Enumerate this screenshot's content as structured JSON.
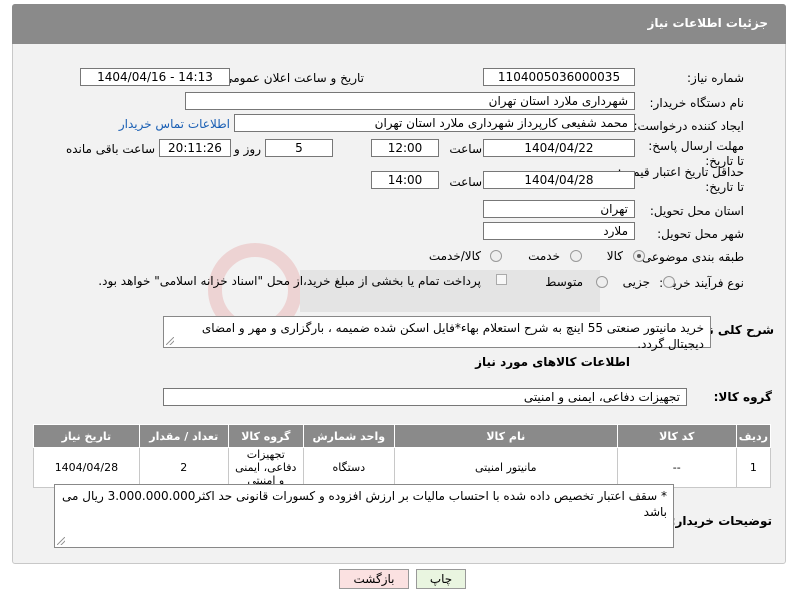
{
  "header": {
    "title": "جزئیات اطلاعات نیاز"
  },
  "form": {
    "need_number_label": "شماره نیاز:",
    "need_number": "1104005036000035",
    "announce_label": "تاریخ و ساعت اعلان عمومی:",
    "announce_value": "1404/04/16 - 14:13",
    "buyer_org_label": "نام دستگاه خریدار:",
    "buyer_org": "شهرداری ملارد استان تهران",
    "requester_label": "ایجاد کننده درخواست:",
    "requester": "محمد شفیعی کارپرداز شهرداری ملارد استان تهران",
    "contact_link": "اطلاعات تماس خریدار",
    "deadline_label": "مهلت ارسال پاسخ: تا تاریخ:",
    "deadline_date": "1404/04/22",
    "time_label": "ساعت",
    "deadline_time": "12:00",
    "days_value": "5",
    "days_label": "روز و",
    "remaining_time": "20:11:26",
    "remaining_label": "ساعت باقی مانده",
    "min_price_label": "حداقل تاریخ اعتبار قیمت: تا تاریخ:",
    "min_price_date": "1404/04/28",
    "min_price_time": "14:00",
    "province_label": "استان محل تحویل:",
    "province": "تهران",
    "city_label": "شهر محل تحویل:",
    "city": "ملارد",
    "category_label": "طبقه بندی موضوعی:",
    "category_options": [
      "کالا",
      "خدمت",
      "کالا/خدمت"
    ],
    "process_label": "نوع فرآیند خرید :",
    "process_options": [
      "جزیی",
      "متوسط"
    ],
    "payment_note": "پرداخت تمام یا بخشی از مبلغ خرید،از محل \"اسناد خزانه اسلامی\" خواهد بود."
  },
  "description": {
    "label": "شرح کلی نیاز:",
    "text": "خرید مانیتور صنعتی 55 اینچ به شرح استعلام بهاء*فایل اسکن شده ضمیمه ، بارگزاری و مهر و امضای دیجیتال گردد."
  },
  "goods": {
    "section_title": "اطلاعات کالاهای مورد نیاز",
    "group_label": "گروه کالا:",
    "group_value": "تجهیزات دفاعی، ایمنی و امنیتی",
    "columns": [
      "ردیف",
      "کد کالا",
      "نام کالا",
      "واحد شمارش",
      "گروه کالا",
      "تعداد / مقدار",
      "تاریخ نیاز"
    ],
    "rows": [
      [
        "1",
        "--",
        "مانیتور امنیتی",
        "دستگاه",
        "تجهیزات دفاعی، ایمنی و امنیتی",
        "2",
        "1404/04/28"
      ]
    ]
  },
  "buyer_notes": {
    "label": "توضیحات خریدار:",
    "text": "* سقف اعتبار تخصیص داده شده با احتساب مالیات بر ارزش افزوده و کسورات قانونی حد اکثر3.000.000.000 ریال می باشد"
  },
  "buttons": {
    "print": "چاپ",
    "back": "بازگشت"
  },
  "colors": {
    "header_bg": "#8a8a8a",
    "panel_bg": "#f2f2f2",
    "link": "#1a5fb4"
  }
}
